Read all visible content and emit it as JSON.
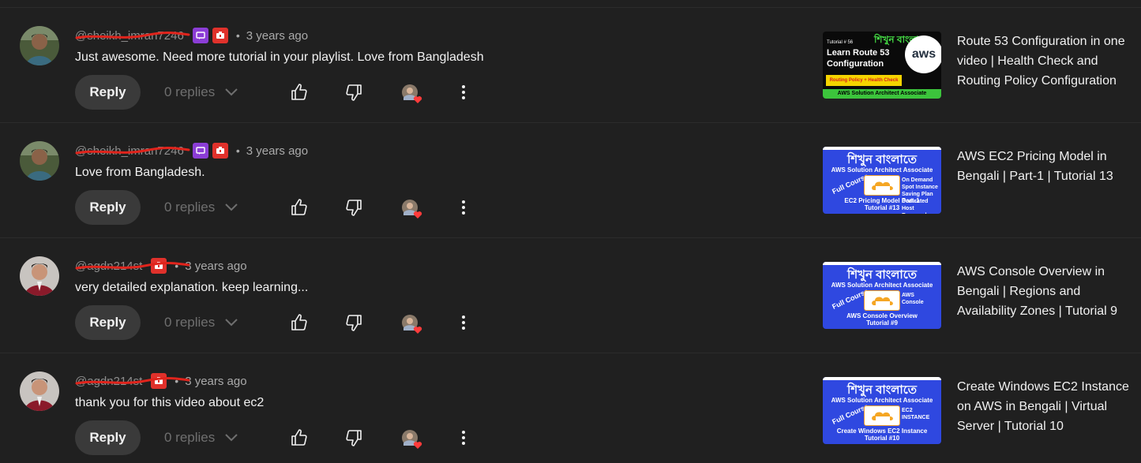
{
  "colors": {
    "background": "#202020",
    "reply_button": "#3a3a3a",
    "badge_member": "#8b3dd6",
    "badge_red": "#e0312b",
    "heart": "#ff3b3b"
  },
  "comments": [
    {
      "handle": "@sheikh_imran7246",
      "badges": [
        "member-badge-icon",
        "red-badge-icon"
      ],
      "time": "3 years ago",
      "text": "Just awesome. Need more tutorial in your playlist. Love from Bangladesh",
      "reply_label": "Reply",
      "replies_label": "0 replies",
      "video": {
        "title": "Route 53 Configuration in one video | Health Check and Routing Policy Configuration",
        "thumb_style": "dark",
        "thumb_top": "শিখুন বাংলাতে",
        "thumb_tutorial": "Tutorial # 56",
        "thumb_main": "Learn Route 53 Configuration",
        "thumb_yellow": "Routing Policy + Health Check",
        "thumb_bar": "AWS Solution Architect Associate",
        "thumb_logo": "aws"
      }
    },
    {
      "handle": "@sheikh_imran7246",
      "badges": [
        "member-badge-icon",
        "red-badge-icon"
      ],
      "time": "3 years ago",
      "text": "Love from Bangladesh.",
      "reply_label": "Reply",
      "replies_label": "0 replies",
      "video": {
        "title": "AWS EC2 Pricing Model in Bengali | Part-1 | Tutorial 13",
        "thumb_style": "blue",
        "thumb_top": "শিখুন বাংলাতে",
        "thumb_arch": "AWS Solution Architect Associate",
        "thumb_course": "Full Course",
        "thumb_side": "On Demand\nSpot Instance\nSaving Plan\nDedicated Host\nReserved Instance",
        "thumb_bottom": "EC2 Pricing Model Part-1\nTutorial #13"
      }
    },
    {
      "handle": "@agdn214st",
      "badges": [
        "red-badge-icon"
      ],
      "time": "3 years ago",
      "text": "very detailed explanation. keep learning...",
      "reply_label": "Reply",
      "replies_label": "0 replies",
      "video": {
        "title": "AWS Console Overview in Bengali | Regions and Availability Zones | Tutorial 9",
        "thumb_style": "blue",
        "thumb_top": "শিখুন বাংলাতে",
        "thumb_arch": "AWS Solution Architect Associate",
        "thumb_course": "Full Course",
        "thumb_side": "AWS\nConsole",
        "thumb_bottom": "AWS Console Overview\nTutorial #9"
      }
    },
    {
      "handle": "@agdn214st",
      "badges": [
        "red-badge-icon"
      ],
      "time": "3 years ago",
      "text": "thank you for this video about ec2",
      "reply_label": "Reply",
      "replies_label": "0 replies",
      "video": {
        "title": "Create Windows EC2 Instance on AWS in Bengali | Virtual Server | Tutorial 10",
        "thumb_style": "blue",
        "thumb_top": "শিখুন বাংলাতে",
        "thumb_arch": "AWS Solution Architect Associate",
        "thumb_course": "Full Course",
        "thumb_side": "EC2\nINSTANCE",
        "thumb_bottom": "Create Windows EC2 Instance\nTutorial #10"
      }
    }
  ]
}
